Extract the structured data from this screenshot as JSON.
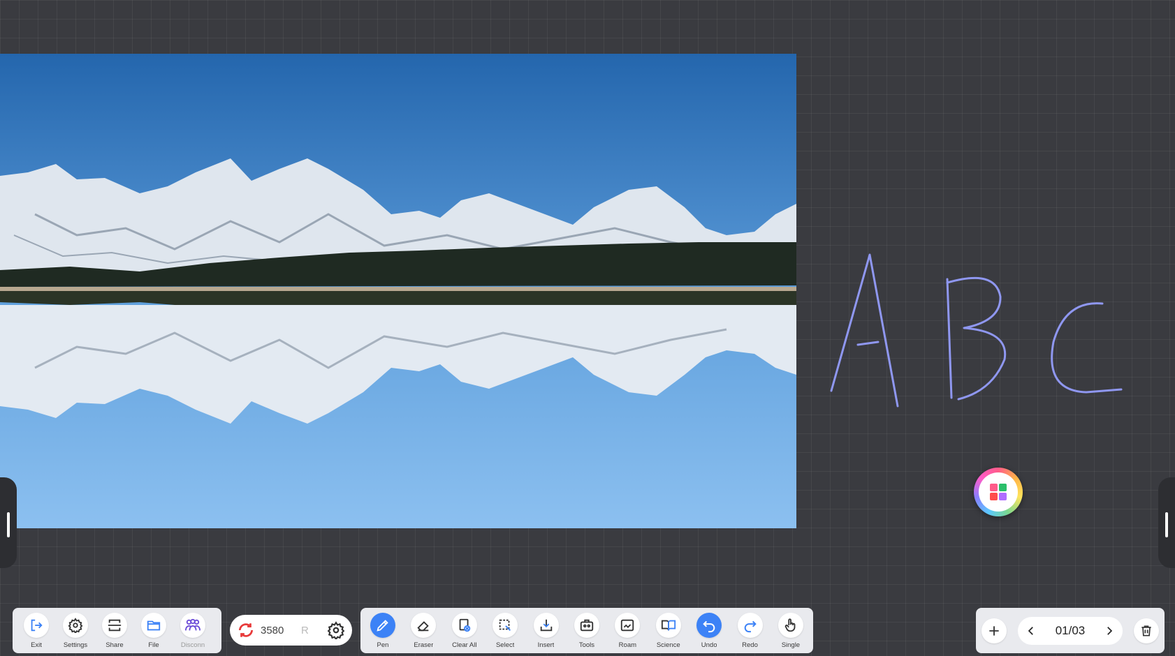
{
  "canvas": {
    "background": "#3a3b40",
    "handwriting": {
      "text": "ABC",
      "color": "#8f97f0"
    }
  },
  "photo": {
    "icon": "landscape-mountain-lake-image"
  },
  "launcher": {
    "icon": "app-grid-icon"
  },
  "left_toolbar": {
    "items": [
      {
        "label": "Exit",
        "icon": "exit-icon"
      },
      {
        "label": "Settings",
        "icon": "gear-icon"
      },
      {
        "label": "Share",
        "icon": "share-screen-icon"
      },
      {
        "label": "File",
        "icon": "folder-icon"
      },
      {
        "label": "Disconn",
        "icon": "people-icon"
      }
    ]
  },
  "sync": {
    "code": "3580",
    "truncated": "R",
    "icon": "sync-icon",
    "settings_icon": "gear-icon"
  },
  "main_toolbar": {
    "items": [
      {
        "label": "Pen",
        "icon": "pen-icon",
        "active": true
      },
      {
        "label": "Eraser",
        "icon": "eraser-icon"
      },
      {
        "label": "Clear All",
        "icon": "clear-all-icon"
      },
      {
        "label": "Select",
        "icon": "select-icon"
      },
      {
        "label": "Insert",
        "icon": "insert-icon"
      },
      {
        "label": "Tools",
        "icon": "toolbox-icon"
      },
      {
        "label": "Roam",
        "icon": "roam-icon"
      },
      {
        "label": "Science",
        "icon": "book-icon"
      },
      {
        "label": "Undo",
        "icon": "undo-icon",
        "active": true
      },
      {
        "label": "Redo",
        "icon": "redo-icon"
      },
      {
        "label": "Single",
        "icon": "hand-pointer-icon"
      }
    ]
  },
  "pager": {
    "current": "01/03",
    "add_icon": "plus-icon",
    "prev_icon": "chevron-left-icon",
    "next_icon": "chevron-right-icon",
    "delete_icon": "trash-icon"
  },
  "colors": {
    "accent": "#3c82f6",
    "toolbar_bg": "#e9eaee"
  }
}
